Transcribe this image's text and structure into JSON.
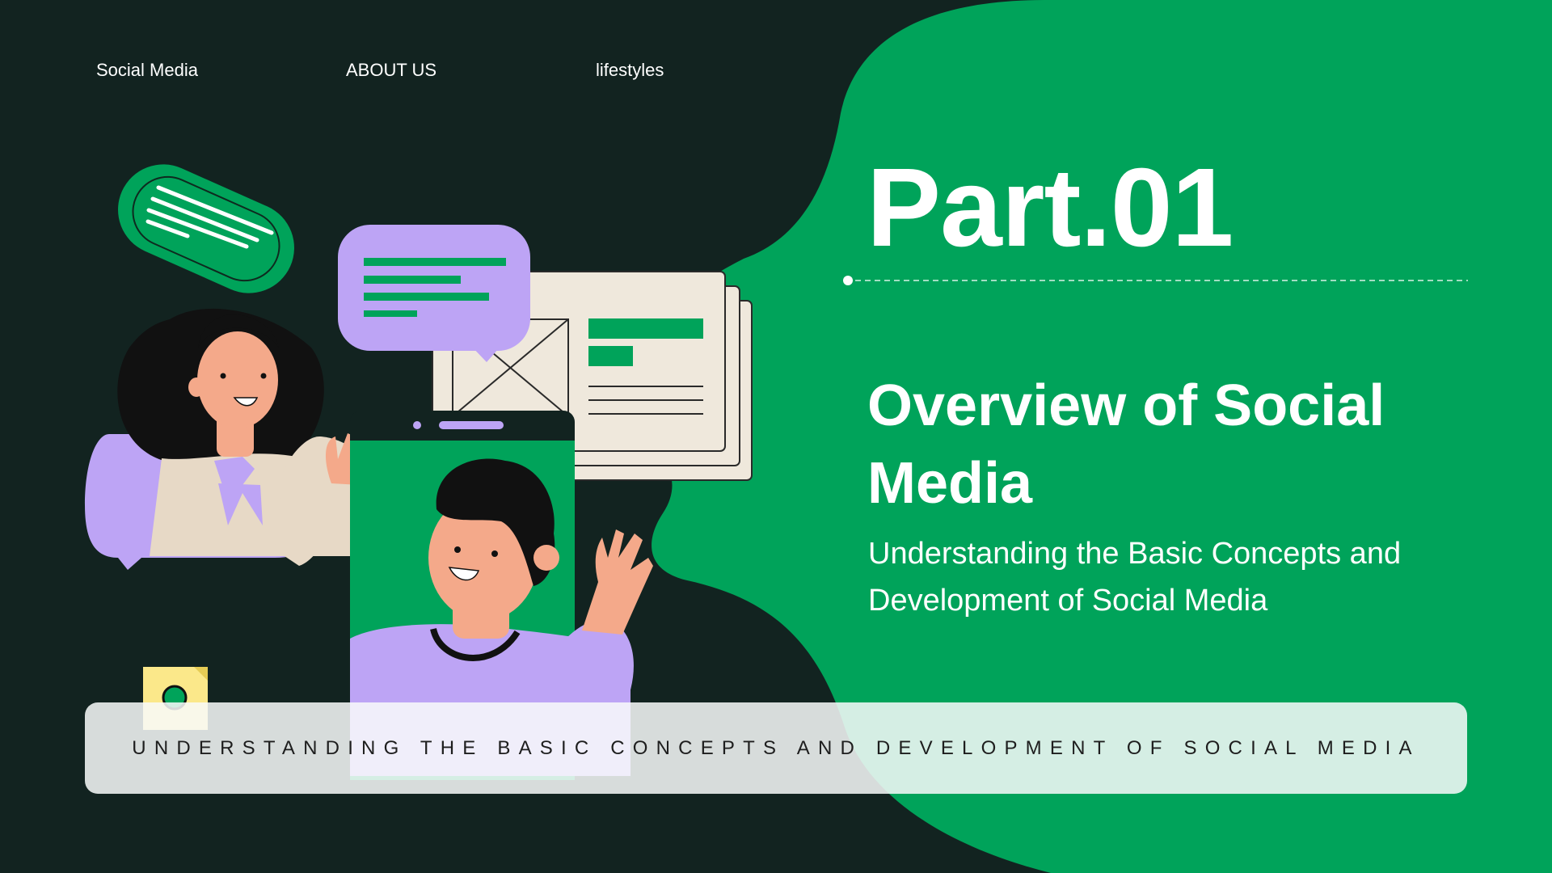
{
  "nav": {
    "items": [
      {
        "label": "Social Media"
      },
      {
        "label": "ABOUT US"
      },
      {
        "label": "lifestyles"
      }
    ]
  },
  "hero": {
    "part_title": "Part.01",
    "heading": "Overview of Social Media",
    "subheading": "Understanding the Basic Concepts and Development of Social Media"
  },
  "banner": {
    "text": "UNDERSTANDING THE BASIC CONCEPTS AND DEVELOPMENT OF SOCIAL MEDIA"
  },
  "colors": {
    "background_dark": "#122320",
    "accent_green": "#00A35A",
    "accent_purple": "#BDA4F5",
    "skin": "#F4A98A",
    "paper": "#EFE8DC",
    "yellow": "#FBE88A"
  },
  "icons": [
    "chat-bubble-icon",
    "message-bubble-icon",
    "browser-window-icon",
    "smartphone-icon",
    "sticky-note-icon"
  ]
}
